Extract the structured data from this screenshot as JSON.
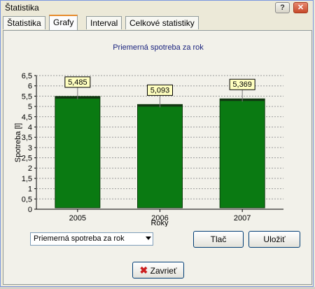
{
  "window": {
    "title": "Štatistika"
  },
  "titlebar_buttons": {
    "help_label": "?",
    "close_label": "✕"
  },
  "tabs": [
    {
      "label": "Štatistika",
      "active": false
    },
    {
      "label": "Grafy",
      "active": true
    },
    {
      "label": "Interval",
      "active": false
    },
    {
      "label": "Celkové statistiky",
      "active": false
    }
  ],
  "controls": {
    "select_value": "Priemerná spotreba za rok",
    "print_label": "Tlač",
    "save_label": "Uložiť",
    "close_label": "Zavrieť"
  },
  "colors": {
    "bar": "#0a7a12",
    "accent_close": "#cc1e1e",
    "title": "#1a237e"
  },
  "chart_data": {
    "type": "bar",
    "title": "Priemerná spotreba za rok",
    "xlabel": "Roky",
    "ylabel": "Spotreba [l]",
    "categories": [
      "2005",
      "2006",
      "2007"
    ],
    "values": [
      5.485,
      5.093,
      5.369
    ],
    "value_labels": [
      "5,485",
      "5,093",
      "5,369"
    ],
    "ylim": [
      0,
      6.5
    ],
    "yticks": [
      "0",
      "0,5",
      "1",
      "1,5",
      "2",
      "2,5",
      "3",
      "3,5",
      "4",
      "4,5",
      "5",
      "5,5",
      "6",
      "6,5"
    ],
    "grid": true,
    "legend": "none"
  }
}
